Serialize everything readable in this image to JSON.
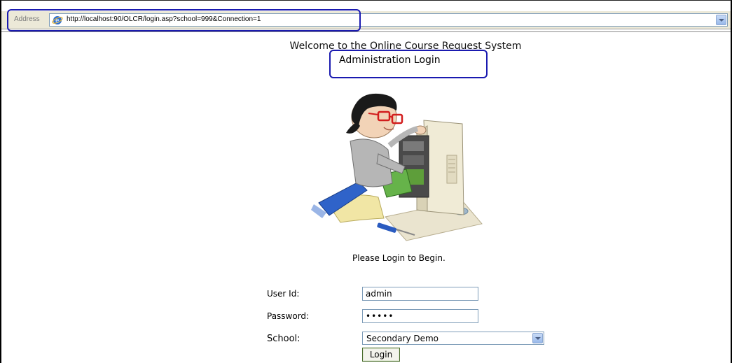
{
  "browser": {
    "address_label": "Address",
    "url": "http://localhost:90/OLCR/login.asp?school=999&Connection=1"
  },
  "page": {
    "welcome": "Welcome to the Online Course Request System",
    "admin_title": "Administration Login",
    "prompt": "Please Login to Begin."
  },
  "form": {
    "user_id_label": "User Id:",
    "user_id_value": "admin",
    "password_label": "Password:",
    "password_value": "•••••",
    "school_label": "School:",
    "school_value": "Secondary Demo",
    "login_label": "Login"
  },
  "colors": {
    "highlight": "#1a1ab0",
    "input_border": "#7f9db9"
  }
}
